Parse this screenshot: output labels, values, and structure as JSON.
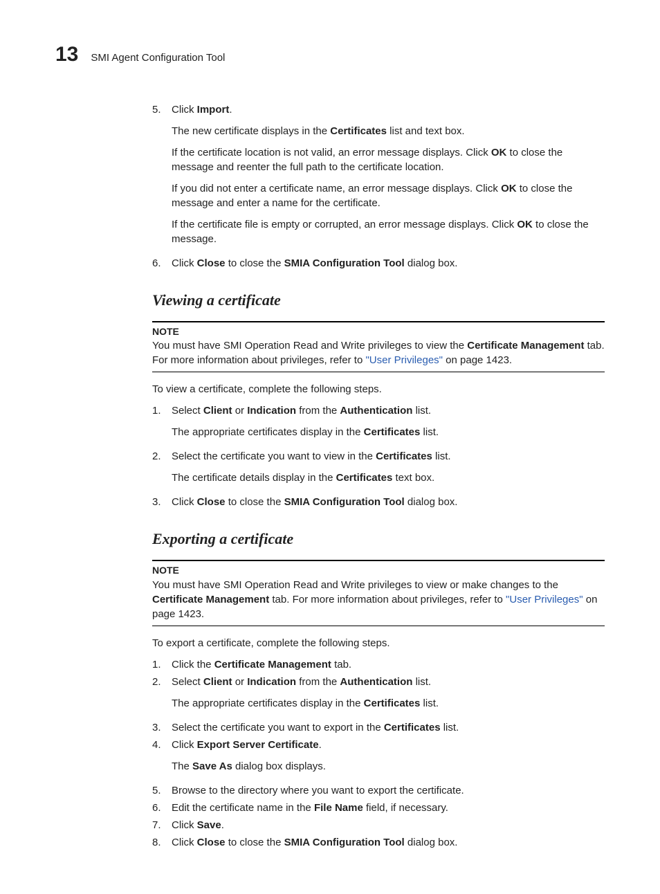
{
  "header": {
    "chapter_number": "13",
    "chapter_title": "SMI Agent Configuration Tool"
  },
  "step5": {
    "num": "5.",
    "text_a": "Click ",
    "text_b": "Import",
    "text_c": ".",
    "p1a": "The new certificate displays in the ",
    "p1b": "Certificates",
    "p1c": " list and text box.",
    "p2a": "If the certificate location is not valid, an error message displays. Click ",
    "p2b": "OK",
    "p2c": " to close the message and reenter the full path to the certificate location.",
    "p3a": "If you did not enter a certificate name, an error message displays. Click ",
    "p3b": "OK",
    "p3c": " to close the message and enter a name for the certificate.",
    "p4a": "If the certificate file is empty or corrupted, an error message displays. Click ",
    "p4b": "OK",
    "p4c": " to close the message."
  },
  "step6": {
    "num": "6.",
    "a": "Click ",
    "b": "Close",
    "c": " to close the ",
    "d": "SMIA Configuration Tool",
    "e": " dialog box."
  },
  "viewing": {
    "heading": "Viewing a certificate",
    "note_label": "NOTE",
    "note_a": "You must have SMI Operation Read and Write privileges to view the ",
    "note_b": "Certificate Management",
    "note_c": " tab. For more information about privileges, refer to ",
    "note_link": "\"User Privileges\"",
    "note_d": " on page 1423.",
    "intro": "To view a certificate, complete the following steps.",
    "s1": {
      "num": "1.",
      "a": "Select ",
      "b": "Client",
      "c": " or ",
      "d": "Indication",
      "e": " from the ",
      "f": "Authentication",
      "g": " list.",
      "sub_a": "The appropriate certificates display in the ",
      "sub_b": "Certificates",
      "sub_c": " list."
    },
    "s2": {
      "num": "2.",
      "a": "Select the certificate you want to view in the ",
      "b": "Certificates",
      "c": " list.",
      "sub_a": "The certificate details display in the ",
      "sub_b": "Certificates",
      "sub_c": " text box."
    },
    "s3": {
      "num": "3.",
      "a": "Click ",
      "b": "Close",
      "c": " to close the ",
      "d": "SMIA Configuration Tool",
      "e": " dialog box."
    }
  },
  "exporting": {
    "heading": "Exporting a certificate",
    "note_label": "NOTE",
    "note_a": "You must have SMI Operation Read and Write privileges to view or make changes to the ",
    "note_b": "Certificate Management",
    "note_c": " tab. For more information about privileges, refer to ",
    "note_link": "\"User Privileges\"",
    "note_d": " on page 1423.",
    "intro": "To export a certificate, complete the following steps.",
    "s1": {
      "num": "1.",
      "a": "Click the ",
      "b": "Certificate Management",
      "c": " tab."
    },
    "s2": {
      "num": "2.",
      "a": "Select ",
      "b": "Client",
      "c": " or ",
      "d": "Indication",
      "e": " from the ",
      "f": "Authentication",
      "g": " list.",
      "sub_a": "The appropriate certificates display in the ",
      "sub_b": "Certificates",
      "sub_c": " list."
    },
    "s3": {
      "num": "3.",
      "a": "Select the certificate you want to export in the ",
      "b": "Certificates",
      "c": " list."
    },
    "s4": {
      "num": "4.",
      "a": "Click ",
      "b": "Export Server Certificate",
      "c": ".",
      "sub_a": "The ",
      "sub_b": "Save As",
      "sub_c": " dialog box displays."
    },
    "s5": {
      "num": "5.",
      "a": "Browse to the directory where you want to export the certificate."
    },
    "s6": {
      "num": "6.",
      "a": "Edit the certificate name in the ",
      "b": "File Name",
      "c": " field, if necessary."
    },
    "s7": {
      "num": "7.",
      "a": "Click ",
      "b": "Save",
      "c": "."
    },
    "s8": {
      "num": "8.",
      "a": "Click ",
      "b": "Close",
      "c": " to close the ",
      "d": "SMIA Configuration Tool",
      "e": " dialog box."
    }
  }
}
